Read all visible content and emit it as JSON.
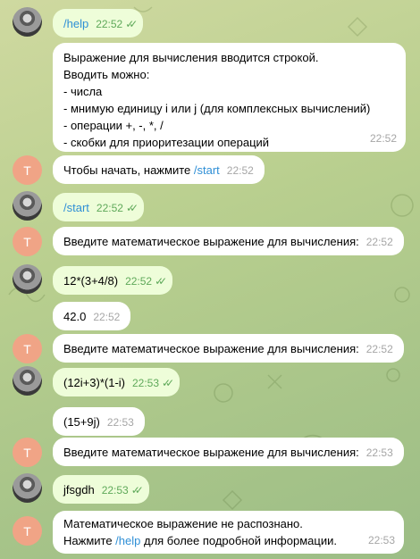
{
  "colors": {
    "outgoing_bubble": "#eefdd9",
    "incoming_bubble": "#ffffff",
    "link": "#2f8fd6",
    "bot_avatar": "#f0a486",
    "check": "#5fa95a"
  },
  "bot_avatar_letter": "T",
  "messages": [
    {
      "from": "user",
      "text": "/help",
      "time": "22:52"
    },
    {
      "from": "bot",
      "lines": [
        "Выражение для вычисления вводится строкой.",
        "Вводить можно:",
        "- числа",
        "- мнимую единицу i или j (для комплексных вычислений)",
        "- операции +, -, *, /",
        "- скобки для приоритезации операций"
      ],
      "time": "22:52"
    },
    {
      "from": "bot",
      "text": "Чтобы начать, нажмите ",
      "link": "/start",
      "time": "22:52"
    },
    {
      "from": "user",
      "text": "/start",
      "time": "22:52"
    },
    {
      "from": "bot",
      "text": "Введите математическое выражение для вычисления:",
      "time": "22:52"
    },
    {
      "from": "user",
      "text": "12*(3+4/8)",
      "time": "22:52"
    },
    {
      "from": "bot",
      "text": "42.0",
      "time": "22:52"
    },
    {
      "from": "bot",
      "text": "Введите математическое выражение для вычисления:",
      "time": "22:52"
    },
    {
      "from": "user",
      "text": "(12i+3)*(1-i)",
      "time": "22:53"
    },
    {
      "from": "bot",
      "text": "(15+9j)",
      "time": "22:53"
    },
    {
      "from": "bot",
      "text": "Введите математическое выражение для вычисления:",
      "time": "22:53"
    },
    {
      "from": "user",
      "text": "jfsgdh",
      "time": "22:53"
    },
    {
      "from": "bot",
      "line1": "Математическое выражение не распознано.",
      "line2_before": "Нажмите ",
      "line2_link": "/help",
      "line2_after": " для более подробной информации.",
      "time": "22:53"
    }
  ]
}
